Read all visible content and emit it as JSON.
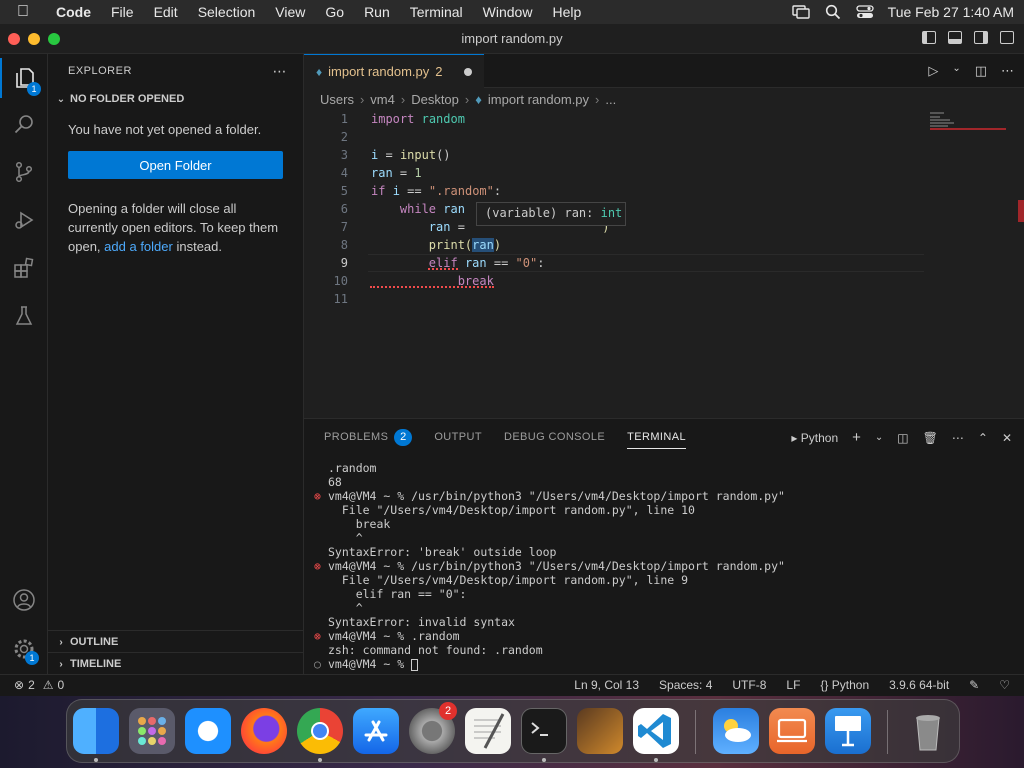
{
  "menubar": {
    "app": "Code",
    "items": [
      "File",
      "Edit",
      "Selection",
      "View",
      "Go",
      "Run",
      "Terminal",
      "Window",
      "Help"
    ],
    "clock": "Tue Feb 27  1:40 AM"
  },
  "window": {
    "title": "import random.py"
  },
  "activity": {
    "explorer_badge": "1",
    "settings_badge": "1"
  },
  "sidebar": {
    "header": "EXPLORER",
    "section": "NO FOLDER OPENED",
    "message": "You have not yet opened a folder.",
    "open_button": "Open Folder",
    "note_before": "Opening a folder will close all currently open editors. To keep them open,",
    "note_link": "add a folder",
    "note_after": "instead.",
    "outline": "OUTLINE",
    "timeline": "TIMELINE"
  },
  "tab": {
    "label": "import random.py",
    "problems": "2"
  },
  "breadcrumb": [
    "Users",
    "vm4",
    "Desktop",
    "import random.py",
    "..."
  ],
  "editor": {
    "line_numbers": [
      "1",
      "2",
      "3",
      "4",
      "5",
      "6",
      "7",
      "8",
      "9",
      "10",
      "11"
    ],
    "hover": {
      "prefix": "(variable) ran: ",
      "type": "int"
    },
    "tokens": {
      "l1": [
        "import",
        "random"
      ],
      "l3": [
        "i",
        "=",
        "input",
        "()"
      ],
      "l4": [
        "ran",
        "=",
        "1"
      ],
      "l5": [
        "if",
        "i",
        "==",
        "\".random\"",
        ":"
      ],
      "l6": [
        "while",
        "ran"
      ],
      "l7": [
        "ran",
        "=",
        ")"
      ],
      "l8": [
        "print",
        "(",
        "ran",
        ")"
      ],
      "l9": [
        "elif",
        "ran",
        "==",
        "\"0\"",
        ":"
      ],
      "l10": [
        "break"
      ]
    }
  },
  "panel": {
    "tabs": [
      "PROBLEMS",
      "OUTPUT",
      "DEBUG CONSOLE",
      "TERMINAL"
    ],
    "problems_count": "2",
    "shell": "Python",
    "terminal": [
      {
        "mark": "",
        "text": ".random"
      },
      {
        "mark": "",
        "text": "68"
      },
      {
        "mark": "err",
        "text": "vm4@VM4 ~ % /usr/bin/python3 \"/Users/vm4/Desktop/import random.py\""
      },
      {
        "mark": "",
        "text": "  File \"/Users/vm4/Desktop/import random.py\", line 10"
      },
      {
        "mark": "",
        "text": "    break"
      },
      {
        "mark": "",
        "text": "    ^"
      },
      {
        "mark": "",
        "text": "SyntaxError: 'break' outside loop"
      },
      {
        "mark": "err",
        "text": "vm4@VM4 ~ % /usr/bin/python3 \"/Users/vm4/Desktop/import random.py\""
      },
      {
        "mark": "",
        "text": "  File \"/Users/vm4/Desktop/import random.py\", line 9"
      },
      {
        "mark": "",
        "text": "    elif ran == \"0\":"
      },
      {
        "mark": "",
        "text": "    ^"
      },
      {
        "mark": "",
        "text": "SyntaxError: invalid syntax"
      },
      {
        "mark": "err",
        "text": "vm4@VM4 ~ % .random"
      },
      {
        "mark": "",
        "text": "zsh: command not found: .random"
      },
      {
        "mark": "ok",
        "text": "vm4@VM4 ~ % "
      }
    ]
  },
  "status": {
    "errors": "2",
    "warnings": "0",
    "position": "Ln 9, Col 13",
    "spaces": "Spaces: 4",
    "encoding": "UTF-8",
    "eol": "LF",
    "language": "Python",
    "interpreter": "3.9.6 64-bit"
  },
  "dock": {
    "settings_badge": "2"
  },
  "colors": {
    "accent": "#0078d4",
    "error": "#f14c4c"
  }
}
